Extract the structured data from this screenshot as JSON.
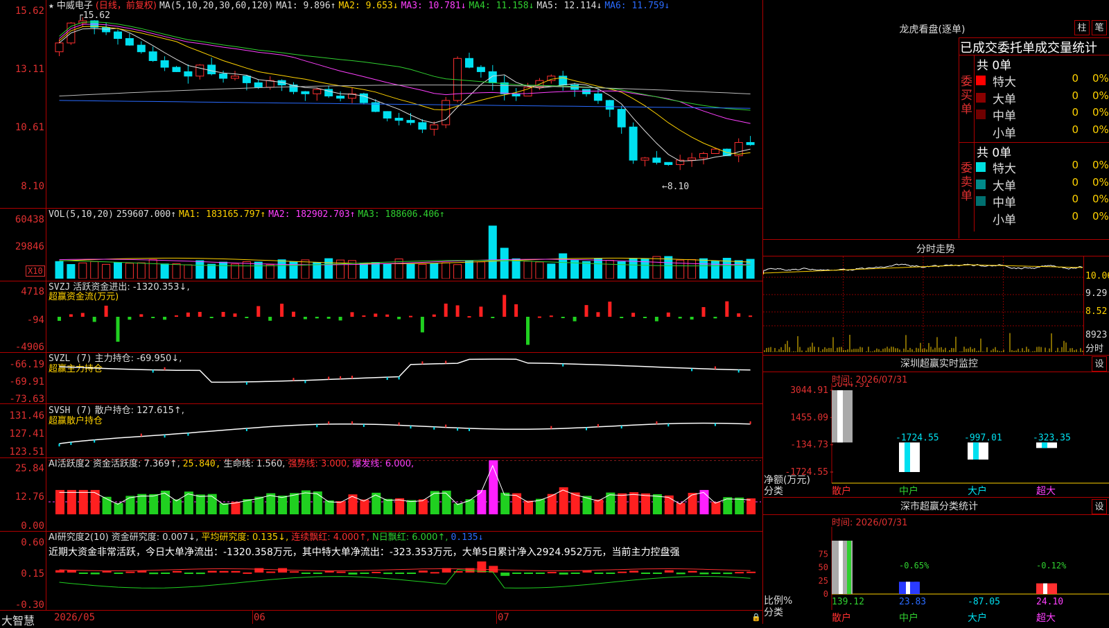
{
  "title_bar": {
    "star": "★",
    "stock_name": "中威电子",
    "period": "(日线，前复权)"
  },
  "main_chart": {
    "ma_header": "MA(5,10,20,30,60,120)",
    "ma": [
      {
        "label": "MA1: 9.896↑",
        "color": "#dddddd"
      },
      {
        "label": "MA2: 9.653↓",
        "color": "#ffd200"
      },
      {
        "label": "MA3: 10.781↓",
        "color": "#ff40ff"
      },
      {
        "label": "MA4: 11.158↓",
        "color": "#30d030"
      },
      {
        "label": "MA5: 12.114↓",
        "color": "#dddddd"
      },
      {
        "label": "MA6: 11.759↓",
        "color": "#2a6bff"
      }
    ],
    "y_ticks": [
      "15.62",
      "13.11",
      "10.61",
      "8.10"
    ],
    "high_label": "15.62",
    "low_label": "←8.10",
    "ylim": [
      8.1,
      15.62
    ]
  },
  "vol_chart": {
    "title": "VOL(5,10,20)",
    "value": "259607.000↑",
    "ma1": "MA1: 183165.797↑",
    "ma2": "MA2: 182902.703↑",
    "ma3": "MA3: 188606.406↑",
    "y_ticks": [
      "60438",
      "29846"
    ],
    "unit": "X10"
  },
  "svzj": {
    "title": "SVZJ",
    "label": "活跃资金进出: -1320.353↓,",
    "subtitle": "超赢资金流(万元)",
    "y_ticks": [
      "4718",
      "-94",
      "-4906"
    ]
  },
  "svzl": {
    "title": "SVZL (7)",
    "label": "主力持仓: -69.950↓,",
    "subtitle": "超赢主力持仓",
    "y_ticks": [
      "-66.19",
      "-69.91",
      "-73.63"
    ]
  },
  "svsh": {
    "title": "SVSH (7)",
    "label": "散户持仓: 127.615↑,",
    "subtitle": "超赢散户持仓",
    "y_ticks": [
      "131.46",
      "127.41",
      "123.51"
    ]
  },
  "ai_active": {
    "title": "AI活跃度2",
    "v1": "资金活跃度: 7.369↑,",
    "v2": "25.840,",
    "v3": "生命线: 1.560,",
    "v4": "强势线: 3.000,",
    "v5": "爆发线: 6.000,",
    "y_ticks": [
      "25.84",
      "12.76",
      "0.00"
    ]
  },
  "ai_research": {
    "title": "AI研究度2(10)",
    "v1": "资金研究度: 0.007↓,",
    "v2": "平均研究度: 0.135↓,",
    "v3": "连续飘红: 4.000↑,",
    "v4": "N日飘红: 6.000↑,",
    "v5": "0.135↓",
    "comment": "近期大资金非常活跃，今日大单净流出：-1320.358万元，其中特大单净流出：-323.353万元，大单5日累计净入2924.952万元，当前主力控盘强",
    "y_ticks": [
      "0.60",
      "0.15",
      "-0.30"
    ]
  },
  "x_axis": {
    "labels": [
      "2026/05",
      "06",
      "07"
    ],
    "brand": "大智慧"
  },
  "longhu": {
    "title": "龙虎看盘(逐单)",
    "btn1": "柱",
    "btn2": "笔",
    "header": "已成交委托单成交量统计",
    "buy": {
      "label": "委买单",
      "count": "共 0单",
      "rows": [
        {
          "name": "特大",
          "v": "0",
          "p": "0%",
          "c": "#ff0000"
        },
        {
          "name": "大单",
          "v": "0",
          "p": "0%",
          "c": "#8a0000"
        },
        {
          "name": "中单",
          "v": "0",
          "p": "0%",
          "c": "#700000"
        },
        {
          "name": "小单",
          "v": "0",
          "p": "0%",
          "c": "#000000"
        }
      ]
    },
    "sell": {
      "label": "委卖单",
      "count": "共 0单",
      "rows": [
        {
          "name": "特大",
          "v": "0",
          "p": "0%",
          "c": "#00e0e0"
        },
        {
          "name": "大单",
          "v": "0",
          "p": "0%",
          "c": "#008a8a"
        },
        {
          "name": "中单",
          "v": "0",
          "p": "0%",
          "c": "#007070"
        },
        {
          "name": "小单",
          "v": "0",
          "p": "0%",
          "c": "#000000"
        }
      ]
    }
  },
  "intraday": {
    "title": "分时走势",
    "y_ticks": [
      "10.06",
      "9.29",
      "8.52",
      "8923"
    ],
    "unit": "分时"
  },
  "sz_monitor": {
    "title": "深圳超赢实时监控",
    "btn": "设",
    "time": "时间: 2026/07/31",
    "y_ticks": [
      "3044.91",
      "1455.09",
      "-134.73",
      "-1724.55"
    ],
    "ylabel": "净额(万元)",
    "xlabel": "分类",
    "chart_data": {
      "type": "bar",
      "categories": [
        "散户",
        "中户",
        "大户",
        "超大"
      ],
      "values": [
        3044.91,
        -1724.55,
        -997.01,
        -323.35
      ],
      "value_labels": [
        "3044.91",
        "-1724.55",
        "-997.01",
        "-323.35"
      ],
      "ylim": [
        -1724.55,
        3044.91
      ]
    }
  },
  "sz_class": {
    "title": "深市超赢分类统计",
    "btn": "设",
    "time": "时间: 2026/07/31",
    "ylabel": "比例%",
    "xlabel": "分类",
    "chart_data": {
      "type": "bar",
      "categories": [
        "散户",
        "中户",
        "大户",
        "超大"
      ],
      "top_labels": [
        "",
        "-0.65%",
        "",
        "-0.12%"
      ],
      "bottom_labels": [
        "139.12",
        "23.83",
        "-87.05",
        "24.10"
      ],
      "values": [
        100,
        23,
        0,
        20
      ],
      "y_ticks": [
        "75",
        "50",
        "25",
        "0"
      ],
      "ylim": [
        0,
        100
      ]
    }
  }
}
